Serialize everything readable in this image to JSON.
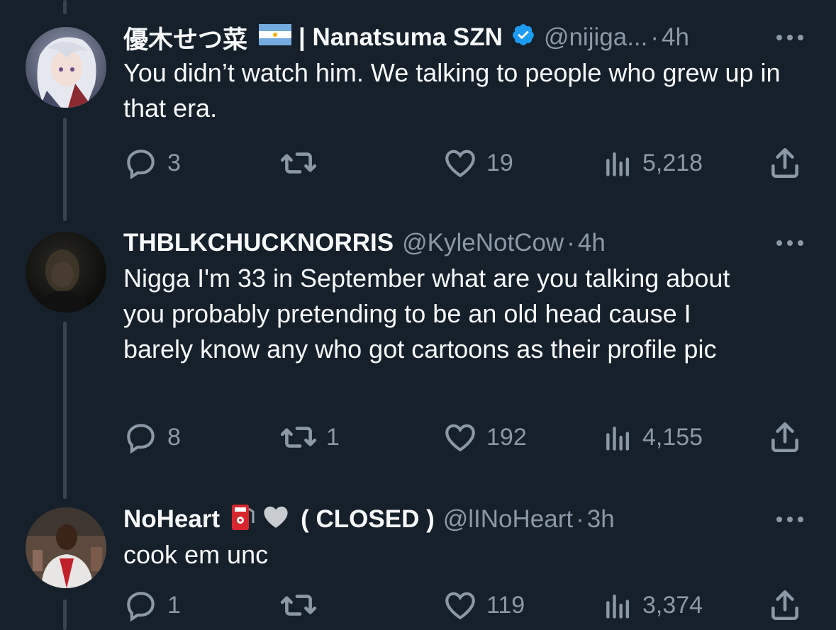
{
  "tweets": [
    {
      "display_name": "優木せつ菜",
      "display_name_suffix": "| Nanatsuma SZN",
      "handle": "@nijiga...",
      "separator": "·",
      "time": "4h",
      "text": "You didn’t watch him. We talking to people who grew up in that era.",
      "replies": "3",
      "reposts": "",
      "likes": "19",
      "views": "5,218",
      "flag_icon": "argentina-flag-icon",
      "verified": true
    },
    {
      "display_name": "THBLKCHUCKNORRIS",
      "handle": "@KyleNotCow",
      "separator": "·",
      "time": "4h",
      "text": "Nigga I'm 33 in September what are you talking about you probably pretending to be an old head cause I barely know any who got cartoons as their profile pic",
      "replies": "8",
      "reposts": "1",
      "likes": "192",
      "views": "4,155"
    },
    {
      "display_name": "NoHeart",
      "display_name_suffix": "( CLOSED )",
      "handle": "@lINoHeart",
      "separator": "·",
      "time": "3h",
      "text": "cook em unc",
      "replies": "1",
      "reposts": "",
      "likes": "119",
      "views": "3,374",
      "emoji_icons": [
        "fuel-pump-icon",
        "white-heart-icon"
      ]
    }
  ],
  "colors": {
    "background": "#15202b",
    "text": "#f7f9f9",
    "secondary": "#8b98a5",
    "thread_line": "#38444d",
    "verified": "#1d9bf0"
  }
}
